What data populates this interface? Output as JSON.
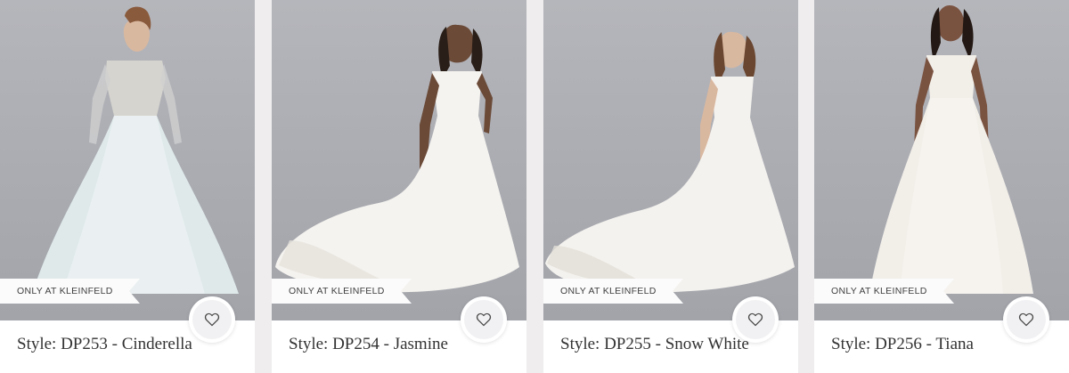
{
  "products": [
    {
      "badge": "ONLY AT KLEINFELD",
      "title": "Style: DP253 - Cinderella",
      "favorite_icon": "heart-outline-icon",
      "gown_color": "#dfe9ea"
    },
    {
      "badge": "ONLY AT KLEINFELD",
      "title": "Style: DP254 - Jasmine",
      "favorite_icon": "heart-outline-icon",
      "gown_color": "#f5f3ef"
    },
    {
      "badge": "ONLY AT KLEINFELD",
      "title": "Style: DP255 - Snow White",
      "favorite_icon": "heart-outline-icon",
      "gown_color": "#f4f2ee"
    },
    {
      "badge": "ONLY AT KLEINFELD",
      "title": "Style: DP256 - Tiana",
      "favorite_icon": "heart-outline-icon",
      "gown_color": "#f2eee8"
    }
  ]
}
